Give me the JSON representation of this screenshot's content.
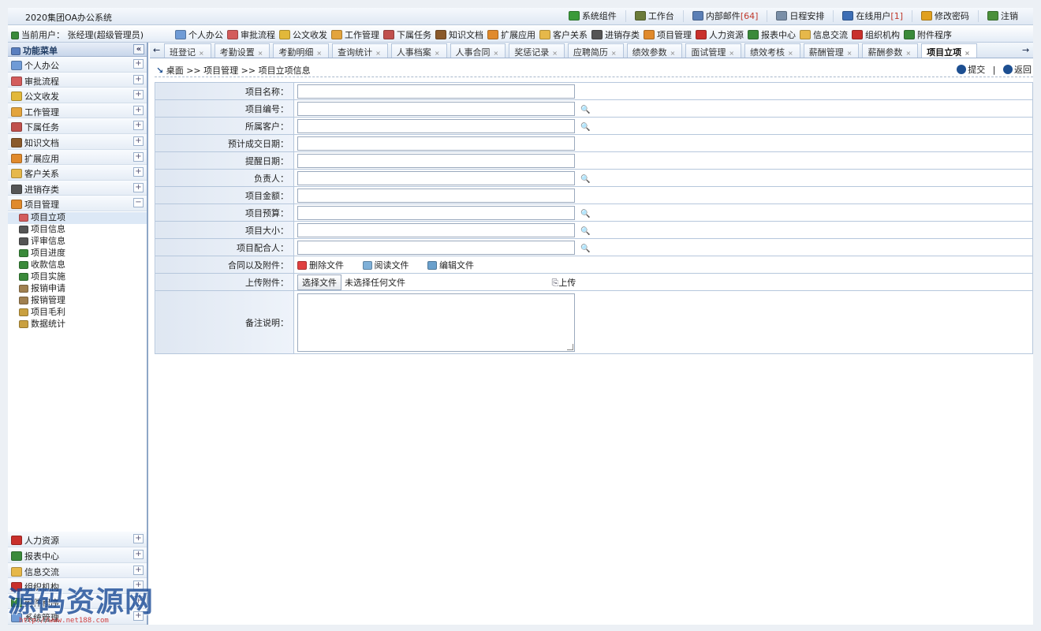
{
  "app": {
    "title": "2020集团OA办公系统"
  },
  "toplinks": [
    {
      "label": "系统组件",
      "icon": "component-icon",
      "color": "#3a9a3a"
    },
    {
      "label": "工作台",
      "icon": "home-icon",
      "color": "#6b7b3a"
    },
    {
      "label": "内部邮件",
      "count": "[64]",
      "icon": "mail-icon",
      "color": "#5b7fb6"
    },
    {
      "label": "日程安排",
      "icon": "calendar-icon",
      "color": "#7a8fa8"
    },
    {
      "label": "在线用户",
      "count": "[1]",
      "icon": "user-icon",
      "color": "#3d6eb5"
    },
    {
      "label": "修改密码",
      "icon": "key-icon",
      "color": "#e0a020"
    },
    {
      "label": "注销",
      "icon": "logout-icon",
      "color": "#4a8f3a"
    }
  ],
  "current_user": "当前用户： 张经理(超级管理员)",
  "shortcuts": [
    {
      "label": "个人办公",
      "color": "#6f9bd6"
    },
    {
      "label": "审批流程",
      "color": "#d35c5c"
    },
    {
      "label": "公文收发",
      "color": "#e2b83a"
    },
    {
      "label": "工作管理",
      "color": "#e3a43d"
    },
    {
      "label": "下属任务",
      "color": "#c0504d"
    },
    {
      "label": "知识文档",
      "color": "#8a5a2b"
    },
    {
      "label": "扩展应用",
      "color": "#e08a2c"
    },
    {
      "label": "客户关系",
      "color": "#e6b84a"
    },
    {
      "label": "进销存类",
      "color": "#555555"
    },
    {
      "label": "项目管理",
      "color": "#e08a2c"
    },
    {
      "label": "人力资源",
      "color": "#c9302c"
    },
    {
      "label": "报表中心",
      "color": "#3a8a3a"
    },
    {
      "label": "信息交流",
      "color": "#e6b84a"
    },
    {
      "label": "组织机构",
      "color": "#c9302c"
    },
    {
      "label": "附件程序",
      "color": "#3a8a3a"
    }
  ],
  "sidebar": {
    "header": "功能菜单",
    "collapse": "«",
    "top_groups": [
      {
        "label": "个人办公",
        "toggle": "+",
        "color": "#6f9bd6"
      },
      {
        "label": "审批流程",
        "toggle": "+",
        "color": "#d35c5c"
      },
      {
        "label": "公文收发",
        "toggle": "+",
        "color": "#e2b83a"
      },
      {
        "label": "工作管理",
        "toggle": "+",
        "color": "#e3a43d"
      },
      {
        "label": "下属任务",
        "toggle": "+",
        "color": "#c0504d"
      },
      {
        "label": "知识文档",
        "toggle": "+",
        "color": "#8a5a2b"
      },
      {
        "label": "扩展应用",
        "toggle": "+",
        "color": "#e08a2c"
      },
      {
        "label": "客户关系",
        "toggle": "+",
        "color": "#e6b84a"
      },
      {
        "label": "进销存类",
        "toggle": "+",
        "color": "#555555"
      },
      {
        "label": "项目管理",
        "toggle": "−",
        "color": "#e08a2c"
      }
    ],
    "sub_items": [
      {
        "label": "项目立项",
        "color": "#d35c5c",
        "selected": true
      },
      {
        "label": "项目信息",
        "color": "#555555"
      },
      {
        "label": "评审信息",
        "color": "#555555"
      },
      {
        "label": "项目进度",
        "color": "#3a8a3a"
      },
      {
        "label": "收款信息",
        "color": "#3a8a3a"
      },
      {
        "label": "项目实施",
        "color": "#3a8a3a"
      },
      {
        "label": "报销申请",
        "color": "#a08050"
      },
      {
        "label": "报销管理",
        "color": "#a08050"
      },
      {
        "label": "项目毛利",
        "color": "#c9a040"
      },
      {
        "label": "数据统计",
        "color": "#c9a040"
      }
    ],
    "bottom_groups": [
      {
        "label": "人力资源",
        "toggle": "+",
        "color": "#c9302c"
      },
      {
        "label": "报表中心",
        "toggle": "+",
        "color": "#3a8a3a"
      },
      {
        "label": "信息交流",
        "toggle": "+",
        "color": "#e6b84a"
      },
      {
        "label": "组织机构",
        "toggle": "+",
        "color": "#c9302c"
      },
      {
        "label": "附件程序",
        "toggle": "+",
        "color": "#3a8a3a"
      },
      {
        "label": "系统管理",
        "toggle": "+",
        "color": "#6f9bd6"
      }
    ]
  },
  "tabs": {
    "left_arrow": "←",
    "right_arrow": "→",
    "items": [
      {
        "label": "班登记"
      },
      {
        "label": "考勤设置"
      },
      {
        "label": "考勤明细"
      },
      {
        "label": "查询统计"
      },
      {
        "label": "人事档案"
      },
      {
        "label": "人事合同"
      },
      {
        "label": "奖惩记录"
      },
      {
        "label": "应聘简历"
      },
      {
        "label": "绩效参数"
      },
      {
        "label": "面试管理"
      },
      {
        "label": "绩效考核"
      },
      {
        "label": "薪酬管理"
      },
      {
        "label": "薪酬参数"
      },
      {
        "label": "项目立项",
        "active": true
      }
    ],
    "close": "×"
  },
  "breadcrumb": "桌面 >> 项目管理 >> 项目立项信息",
  "actions": {
    "submit": "提交",
    "back": "返回",
    "sep": "|"
  },
  "form": {
    "fields": [
      {
        "label": "项目名称：",
        "lookup": false,
        "value": ""
      },
      {
        "label": "项目编号：",
        "lookup": true,
        "value": ""
      },
      {
        "label": "所属客户：",
        "lookup": true,
        "value": ""
      },
      {
        "label": "预计成交日期：",
        "lookup": false,
        "value": ""
      },
      {
        "label": "提醒日期：",
        "lookup": false,
        "value": ""
      },
      {
        "label": "负责人：",
        "lookup": true,
        "value": ""
      },
      {
        "label": "项目金额：",
        "lookup": false,
        "value": ""
      },
      {
        "label": "项目预算：",
        "lookup": true,
        "value": ""
      },
      {
        "label": "项目大小：",
        "lookup": true,
        "value": ""
      },
      {
        "label": "项目配合人：",
        "lookup": true,
        "value": ""
      }
    ],
    "attachments": {
      "label": "合同以及附件：",
      "delete": "删除文件",
      "read": "阅读文件",
      "edit": "编辑文件"
    },
    "upload": {
      "label": "上传附件：",
      "choose": "选择文件",
      "none": "未选择任何文件",
      "upload": "上传"
    },
    "remark": {
      "label": "备注说明：",
      "value": ""
    }
  },
  "watermark": {
    "text": "源码资源网",
    "url": "http://www.net188.com"
  }
}
